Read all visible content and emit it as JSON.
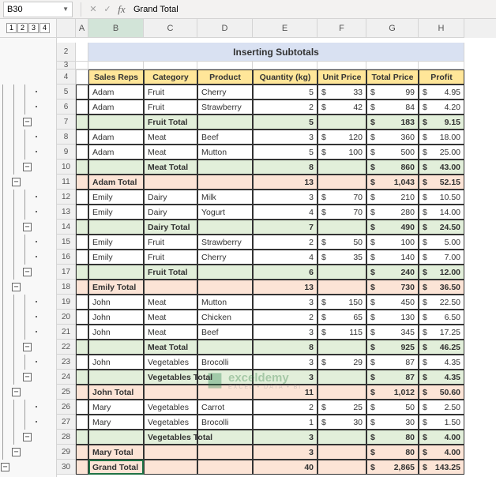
{
  "namebox": {
    "cell": "B30"
  },
  "formula": {
    "value": "Grand Total"
  },
  "outline_levels": [
    "1",
    "2",
    "3",
    "4"
  ],
  "col_headers": [
    "A",
    "B",
    "C",
    "D",
    "E",
    "F",
    "G",
    "H"
  ],
  "title": "Inserting Subtotals",
  "headers": {
    "b": "Sales Reps",
    "c": "Category",
    "d": "Product",
    "e": "Quantity (kg)",
    "f": "Unit Price",
    "g": "Total Price",
    "h": "Profit"
  },
  "chart_data": {
    "type": "table",
    "title": "Inserting Subtotals",
    "columns": [
      "Sales Reps",
      "Category",
      "Product",
      "Quantity (kg)",
      "Unit Price",
      "Total Price",
      "Profit"
    ],
    "rows": [
      {
        "n": 5,
        "t": "d",
        "b": "Adam",
        "c": "Fruit",
        "d": "Cherry",
        "e": "5",
        "f": "33",
        "g": "99",
        "h": "4.95"
      },
      {
        "n": 6,
        "t": "d",
        "b": "Adam",
        "c": "Fruit",
        "d": "Strawberry",
        "e": "2",
        "f": "42",
        "g": "84",
        "h": "4.20"
      },
      {
        "n": 7,
        "t": "sg",
        "c": "Fruit Total",
        "e": "5",
        "g": "183",
        "h": "9.15"
      },
      {
        "n": 8,
        "t": "d",
        "b": "Adam",
        "c": "Meat",
        "d": "Beef",
        "e": "3",
        "f": "120",
        "g": "360",
        "h": "18.00"
      },
      {
        "n": 9,
        "t": "d",
        "b": "Adam",
        "c": "Meat",
        "d": "Mutton",
        "e": "5",
        "f": "100",
        "g": "500",
        "h": "25.00"
      },
      {
        "n": 10,
        "t": "sg",
        "c": "Meat Total",
        "e": "8",
        "g": "860",
        "h": "43.00"
      },
      {
        "n": 11,
        "t": "sp",
        "b": "Adam Total",
        "e": "13",
        "g": "1,043",
        "h": "52.15"
      },
      {
        "n": 12,
        "t": "d",
        "b": "Emily",
        "c": "Dairy",
        "d": "Milk",
        "e": "3",
        "f": "70",
        "g": "210",
        "h": "10.50"
      },
      {
        "n": 13,
        "t": "d",
        "b": "Emily",
        "c": "Dairy",
        "d": "Yogurt",
        "e": "4",
        "f": "70",
        "g": "280",
        "h": "14.00"
      },
      {
        "n": 14,
        "t": "sg",
        "c": "Dairy Total",
        "e": "7",
        "g": "490",
        "h": "24.50"
      },
      {
        "n": 15,
        "t": "d",
        "b": "Emily",
        "c": "Fruit",
        "d": "Strawberry",
        "e": "2",
        "f": "50",
        "g": "100",
        "h": "5.00"
      },
      {
        "n": 16,
        "t": "d",
        "b": "Emily",
        "c": "Fruit",
        "d": "Cherry",
        "e": "4",
        "f": "35",
        "g": "140",
        "h": "7.00"
      },
      {
        "n": 17,
        "t": "sg",
        "c": "Fruit Total",
        "e": "6",
        "g": "240",
        "h": "12.00"
      },
      {
        "n": 18,
        "t": "sp",
        "b": "Emily Total",
        "e": "13",
        "g": "730",
        "h": "36.50"
      },
      {
        "n": 19,
        "t": "d",
        "b": "John",
        "c": "Meat",
        "d": "Mutton",
        "e": "3",
        "f": "150",
        "g": "450",
        "h": "22.50"
      },
      {
        "n": 20,
        "t": "d",
        "b": "John",
        "c": "Meat",
        "d": "Chicken",
        "e": "2",
        "f": "65",
        "g": "130",
        "h": "6.50"
      },
      {
        "n": 21,
        "t": "d",
        "b": "John",
        "c": "Meat",
        "d": "Beef",
        "e": "3",
        "f": "115",
        "g": "345",
        "h": "17.25"
      },
      {
        "n": 22,
        "t": "sg",
        "c": "Meat Total",
        "e": "8",
        "g": "925",
        "h": "46.25"
      },
      {
        "n": 23,
        "t": "d",
        "b": "John",
        "c": "Vegetables",
        "d": "Brocolli",
        "e": "3",
        "f": "29",
        "g": "87",
        "h": "4.35"
      },
      {
        "n": 24,
        "t": "sg",
        "c": "Vegetables Total",
        "e": "3",
        "g": "87",
        "h": "4.35"
      },
      {
        "n": 25,
        "t": "sp",
        "b": "John Total",
        "e": "11",
        "g": "1,012",
        "h": "50.60"
      },
      {
        "n": 26,
        "t": "d",
        "b": "Mary",
        "c": "Vegetables",
        "d": "Carrot",
        "e": "2",
        "f": "25",
        "g": "50",
        "h": "2.50"
      },
      {
        "n": 27,
        "t": "d",
        "b": "Mary",
        "c": "Vegetables",
        "d": "Brocolli",
        "e": "1",
        "f": "30",
        "g": "30",
        "h": "1.50"
      },
      {
        "n": 28,
        "t": "sg",
        "c": "Vegetables Total",
        "e": "3",
        "g": "80",
        "h": "4.00"
      },
      {
        "n": 29,
        "t": "sp",
        "b": "Mary Total",
        "e": "3",
        "g": "80",
        "h": "4.00"
      },
      {
        "n": 30,
        "t": "sp",
        "b": "Grand Total",
        "e": "40",
        "g": "2,865",
        "h": "143.25"
      }
    ]
  },
  "watermark": {
    "brand": "exceldemy",
    "tag": "EXCEL • DATA • BI"
  }
}
